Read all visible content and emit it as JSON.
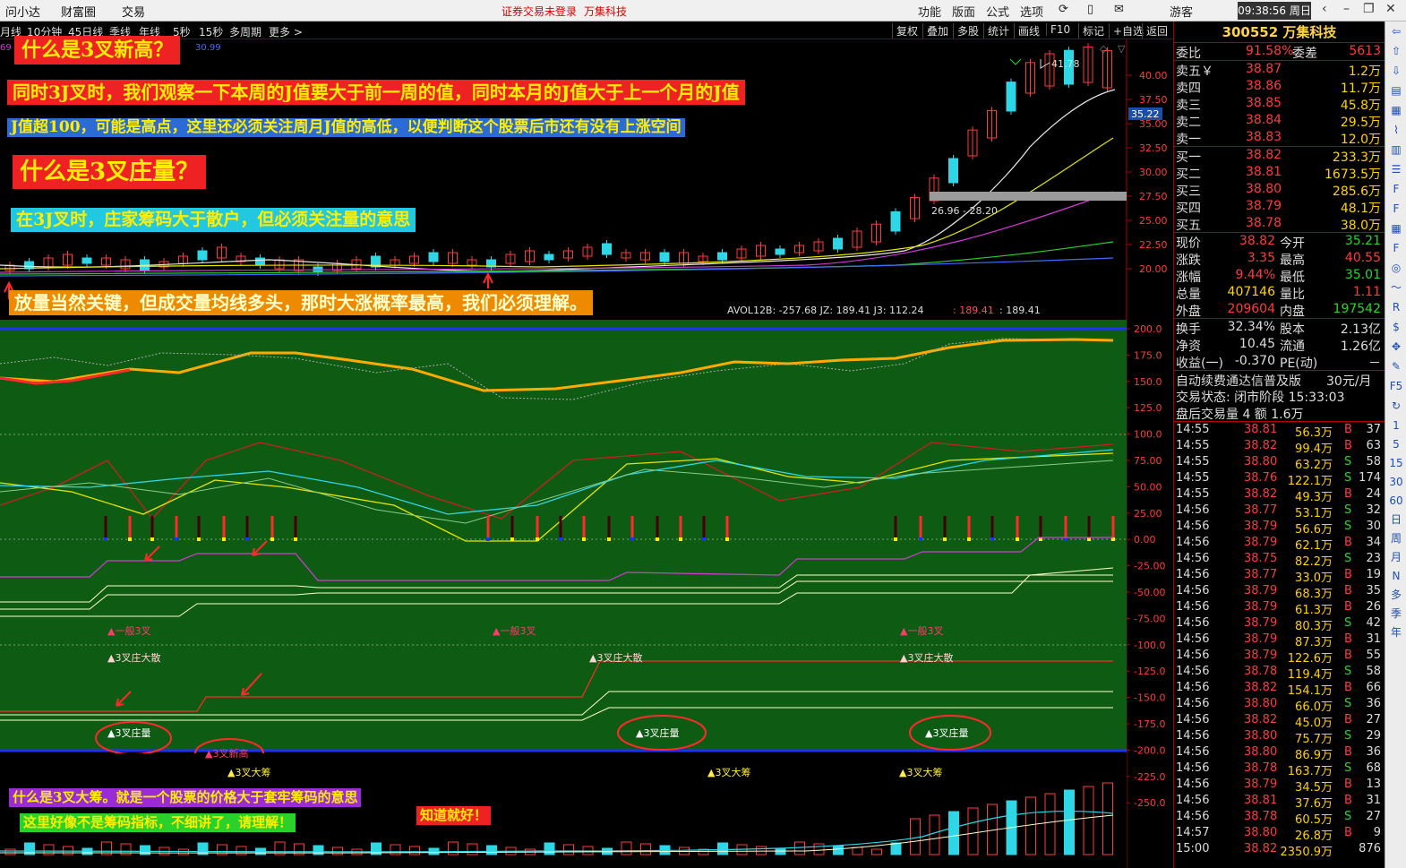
{
  "titlebar": {
    "menus": [
      "问小达",
      "财富圈",
      "交易"
    ],
    "center_notice": "证券交易未登录",
    "center_stock": "万集科技",
    "tools": [
      "功能",
      "版面",
      "公式",
      "选项"
    ],
    "user": "游客",
    "clock": "09:38:56 周日"
  },
  "periodbar": {
    "periods": [
      "月线",
      "10分钟",
      "45日线",
      "季线",
      "年线",
      "5秒",
      "15秒",
      "多周期",
      "更多 >"
    ],
    "right_tools": [
      "复权",
      "叠加",
      "多股",
      "统计",
      "画线",
      "F10",
      "标记",
      "+自选",
      "返回"
    ]
  },
  "price_chart": {
    "axis_ticks": [
      "40.00",
      "37.50",
      "35.00",
      "32.50",
      "30.00",
      "27.50",
      "25.00",
      "22.50",
      "20.00"
    ],
    "current_price_tag": "35.22",
    "high_label": "41.78",
    "range_label": "26.96 - 28.20",
    "top_left_values": [
      "69",
      "30.99"
    ]
  },
  "indicator_header": {
    "text": "AVOL12B: -257.68  JZ: 189.41  J3: 112.24",
    "red_value": ": 189.41",
    "last_value": ": 189.41"
  },
  "indicator_chart": {
    "axis_ticks": [
      "200.0",
      "175.0",
      "150.0",
      "125.0",
      "100.0",
      "75.00",
      "50.00",
      "25.00",
      "0.00",
      "-25.00",
      "-50.00",
      "-75.00",
      "-100.0",
      "-125.0",
      "-150.0",
      "-175.0",
      "-200.0",
      "-225.0",
      "-250.0"
    ],
    "signals": {
      "general_3x": [
        "▲一般3叉",
        "▲一般3叉",
        "▲一般3叉"
      ],
      "dealer_scatter": [
        "▲3叉庄大散",
        "▲3叉庄大散",
        "▲3叉庄大散"
      ],
      "dealer_volume": [
        "▲3叉庄量",
        "▲3叉庄量",
        "▲3叉庄量"
      ],
      "new_high": "▲3叉新高",
      "big_chips": [
        "▲3叉大筹",
        "▲3叉大筹",
        "▲3叉大筹"
      ]
    }
  },
  "notes": {
    "n1": "什么是3叉新高？",
    "n2": "同时3J叉时，我们观察一下本周的J值要大于前一周的值，同时本月的J值大于上一个月的J值",
    "n3": "J值超100，可能是高点，这里还必须关注周月J值的高低，以便判断这个股票后市还有没有上涨空间",
    "n4": "什么是3叉庄量？",
    "n5": "在3J叉时，庄家筹码大于散户，但必须关注量的意思",
    "n6": "放量当然关键，但成交量均线多头，那时大涨概率最高，我们必须理解。",
    "n7": "什么是3叉大筹。就是一个股票的价格大于套牢筹码的意思",
    "n8": "这里好像不是筹码指标，不细讲了，请理解！",
    "n9": "知道就好！"
  },
  "quote_panel": {
    "code": "300552",
    "name": "万集科技",
    "weibi_label": "委比",
    "weibi_pct": "91.58%",
    "weicha_label": "委差",
    "weicha": "5613",
    "sell": [
      {
        "label": "卖五￥",
        "price": "38.87",
        "vol": "1.2万"
      },
      {
        "label": "卖四",
        "price": "38.86",
        "vol": "11.7万"
      },
      {
        "label": "卖三",
        "price": "38.85",
        "vol": "45.8万"
      },
      {
        "label": "卖二",
        "price": "38.84",
        "vol": "29.5万"
      },
      {
        "label": "卖一",
        "price": "38.83",
        "vol": "12.0万"
      }
    ],
    "buy": [
      {
        "label": "买一",
        "price": "38.82",
        "vol": "233.3万"
      },
      {
        "label": "买二",
        "price": "38.81",
        "vol": "1673.5万"
      },
      {
        "label": "买三",
        "price": "38.80",
        "vol": "285.6万"
      },
      {
        "label": "买四",
        "price": "38.79",
        "vol": "48.1万"
      },
      {
        "label": "买五",
        "price": "38.78",
        "vol": "38.0万"
      }
    ],
    "stats": [
      {
        "l1": "现价",
        "v1": "38.82",
        "l2": "今开",
        "v2": "35.21"
      },
      {
        "l1": "涨跌",
        "v1": "3.35",
        "l2": "最高",
        "v2": "40.55"
      },
      {
        "l1": "涨幅",
        "v1": "9.44%",
        "l2": "最低",
        "v2": "35.01"
      },
      {
        "l1": "总量",
        "v1": "407146",
        "l2": "量比",
        "v2": "1.11"
      },
      {
        "l1": "外盘",
        "v1": "209604",
        "l2": "内盘",
        "v2": "197542"
      }
    ],
    "fund": [
      {
        "l1": "换手",
        "v1": "32.34%",
        "l2": "股本",
        "v2": "2.13亿"
      },
      {
        "l1": "净资",
        "v1": "10.45",
        "l2": "流通",
        "v2": "1.26亿"
      },
      {
        "l1": "收益(一)",
        "v1": "-0.370",
        "l2": "PE(动)",
        "v2": "－"
      }
    ],
    "ad_text": "自动续费通达信普及版",
    "ad_price": "30元/月",
    "status_line": "交易状态: 闭市阶段 15:33:03",
    "after_line": "盘后交易量 4 额 1.6万",
    "ticks": [
      {
        "t": "14:55",
        "p": "38.81",
        "v": "56.3万",
        "s": "B",
        "n": "37"
      },
      {
        "t": "14:55",
        "p": "38.82",
        "v": "99.4万",
        "s": "B",
        "n": "63"
      },
      {
        "t": "14:55",
        "p": "38.80",
        "v": "63.2万",
        "s": "S",
        "n": "58"
      },
      {
        "t": "14:55",
        "p": "38.76",
        "v": "122.1万",
        "s": "S",
        "n": "174"
      },
      {
        "t": "14:55",
        "p": "38.82",
        "v": "49.3万",
        "s": "B",
        "n": "24"
      },
      {
        "t": "14:56",
        "p": "38.77",
        "v": "53.1万",
        "s": "S",
        "n": "32"
      },
      {
        "t": "14:56",
        "p": "38.79",
        "v": "56.6万",
        "s": "S",
        "n": "30"
      },
      {
        "t": "14:56",
        "p": "38.79",
        "v": "62.1万",
        "s": "B",
        "n": "34"
      },
      {
        "t": "14:56",
        "p": "38.75",
        "v": "82.2万",
        "s": "S",
        "n": "23"
      },
      {
        "t": "14:56",
        "p": "38.77",
        "v": "33.0万",
        "s": "B",
        "n": "19"
      },
      {
        "t": "14:56",
        "p": "38.79",
        "v": "68.3万",
        "s": "B",
        "n": "35"
      },
      {
        "t": "14:56",
        "p": "38.79",
        "v": "61.3万",
        "s": "B",
        "n": "26"
      },
      {
        "t": "14:56",
        "p": "38.79",
        "v": "80.3万",
        "s": "S",
        "n": "42"
      },
      {
        "t": "14:56",
        "p": "38.79",
        "v": "87.3万",
        "s": "B",
        "n": "31"
      },
      {
        "t": "14:56",
        "p": "38.79",
        "v": "122.6万",
        "s": "B",
        "n": "55"
      },
      {
        "t": "14:56",
        "p": "38.78",
        "v": "119.4万",
        "s": "S",
        "n": "58"
      },
      {
        "t": "14:56",
        "p": "38.82",
        "v": "154.1万",
        "s": "B",
        "n": "66"
      },
      {
        "t": "14:56",
        "p": "38.80",
        "v": "66.0万",
        "s": "S",
        "n": "36"
      },
      {
        "t": "14:56",
        "p": "38.82",
        "v": "45.0万",
        "s": "B",
        "n": "27"
      },
      {
        "t": "14:56",
        "p": "38.80",
        "v": "75.7万",
        "s": "S",
        "n": "29"
      },
      {
        "t": "14:56",
        "p": "38.80",
        "v": "86.9万",
        "s": "B",
        "n": "36"
      },
      {
        "t": "14:56",
        "p": "38.78",
        "v": "163.7万",
        "s": "S",
        "n": "68"
      },
      {
        "t": "14:56",
        "p": "38.79",
        "v": "34.5万",
        "s": "B",
        "n": "13"
      },
      {
        "t": "14:56",
        "p": "38.81",
        "v": "37.6万",
        "s": "B",
        "n": "31"
      },
      {
        "t": "14:56",
        "p": "38.78",
        "v": "60.5万",
        "s": "S",
        "n": "27"
      },
      {
        "t": "14:57",
        "p": "38.80",
        "v": "26.8万",
        "s": "B",
        "n": "9"
      },
      {
        "t": "15:00",
        "p": "38.82",
        "v": "2350.9万",
        "s": "",
        "n": "876"
      }
    ]
  },
  "strip_icons": [
    "arrow-left-icon",
    "arrow-up-icon",
    "arrow-down-icon",
    "document-icon",
    "grid-icon",
    "chart-icon",
    "bar-icon",
    "list-icon",
    "f-icon",
    "f-icon",
    "table-icon",
    "f-icon",
    "circle-icon",
    "line-icon",
    "rsi-icon",
    "money-icon",
    "move-icon",
    "pen-icon",
    "f5-icon",
    "refresh-icon"
  ],
  "strip_labels": [
    "1",
    "5",
    "15",
    "30",
    "60",
    "日",
    "周",
    "月",
    "N",
    "多",
    "季",
    "年"
  ],
  "colors": {
    "background": "#000000",
    "indicator_bg": "#0e5b14",
    "up_red": "#ff3b3b",
    "down_cyan": "#2fd6e6",
    "panel_border": "#aa0000",
    "accent_yellow": "#ffd200"
  }
}
